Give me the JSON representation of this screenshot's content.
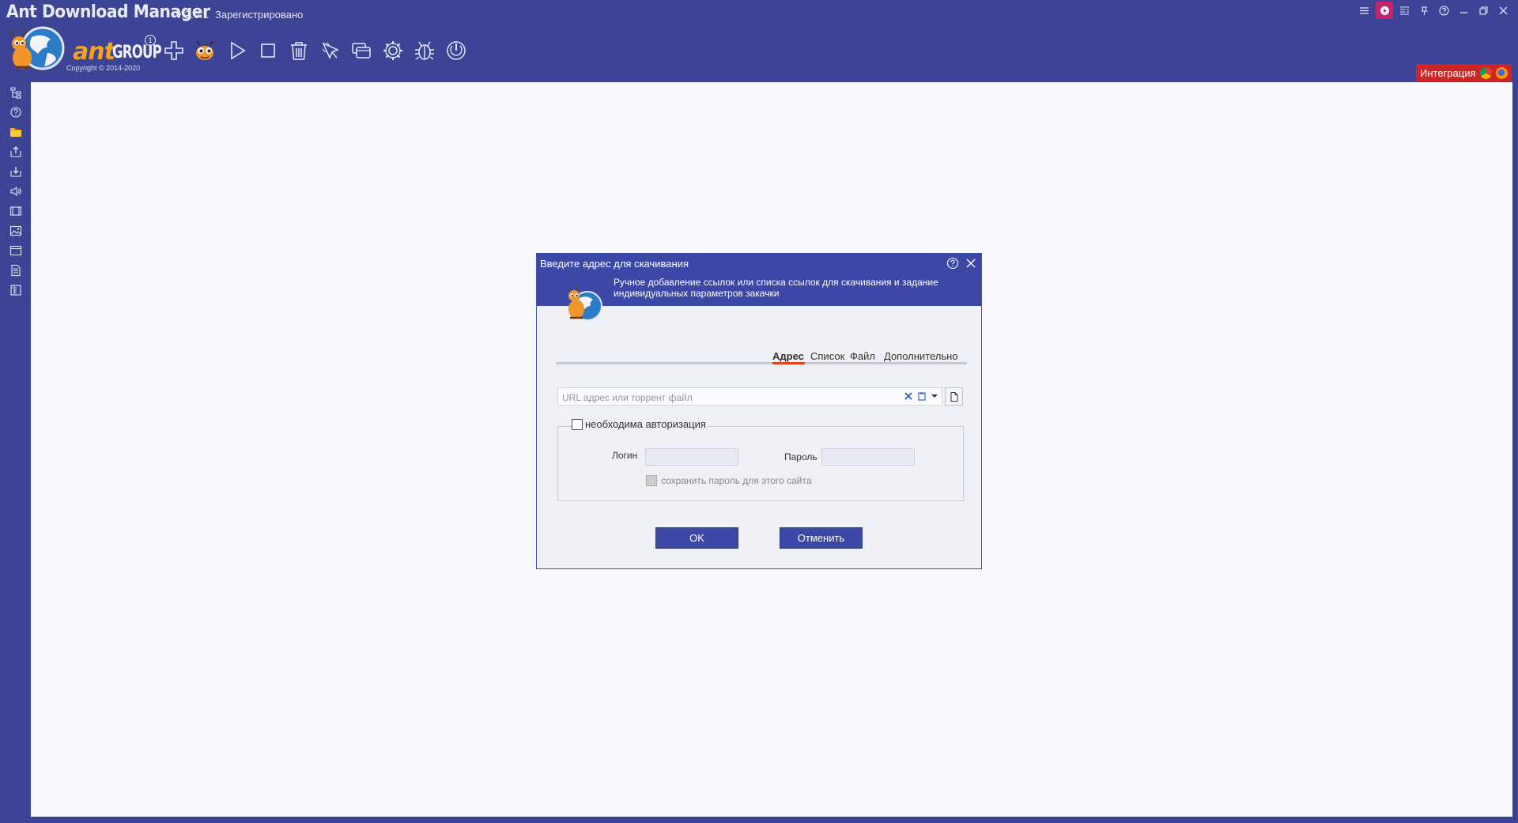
{
  "titlebar": {
    "app_name": "Ant Download Manager",
    "version": "v.2.0.1",
    "registration": "Зарегистрировано",
    "controls": [
      "menu-icon",
      "record-icon",
      "layout-icon",
      "pin-icon",
      "help-icon",
      "minimize-icon",
      "restore-icon",
      "close-icon"
    ]
  },
  "toolbar": {
    "brand_word": "ant",
    "brand_group": "GROUP",
    "brand_mark": "1",
    "copyright": "Copyright © 2014-2020",
    "buttons": [
      "add-icon",
      "ant-mascot-icon",
      "play-icon",
      "stop-icon",
      "delete-icon",
      "pointer-icon",
      "windows-icon",
      "settings-icon",
      "bug-icon",
      "power-icon"
    ]
  },
  "integration": {
    "label": "Интеграция",
    "browsers": [
      "chrome-icon",
      "firefox-icon"
    ]
  },
  "sidebar": {
    "items": [
      "tree-icon",
      "question-icon",
      "folder-icon",
      "upload-icon",
      "download-icon",
      "audio-icon",
      "video-icon",
      "image-icon",
      "window-icon",
      "document-icon",
      "archive-icon"
    ]
  },
  "dialog": {
    "title": "Введите адрес для скачивания",
    "description": "Ручное добавление ссылок или списка ссылок для скачивания и задание индивидуальных параметров закачки",
    "tabs": [
      {
        "label": "Адрес",
        "active": true
      },
      {
        "label": "Список",
        "active": false
      },
      {
        "label": "Файл",
        "active": false
      },
      {
        "label": "Дополнительно",
        "active": false
      }
    ],
    "url_placeholder": "URL адрес или торрент файл",
    "auth_label": "необходима авторизация",
    "login_label": "Логин",
    "password_label": "Пароль",
    "save_password_label": "сохранить пароль для этого сайта",
    "ok_label": "OK",
    "cancel_label": "Отменить"
  },
  "colors": {
    "background": "#3d4496",
    "dialog_header": "#3b48a6",
    "accent_tab": "#e0481c",
    "integration": "#cf2527",
    "brand_orange": "#f4a11c"
  }
}
